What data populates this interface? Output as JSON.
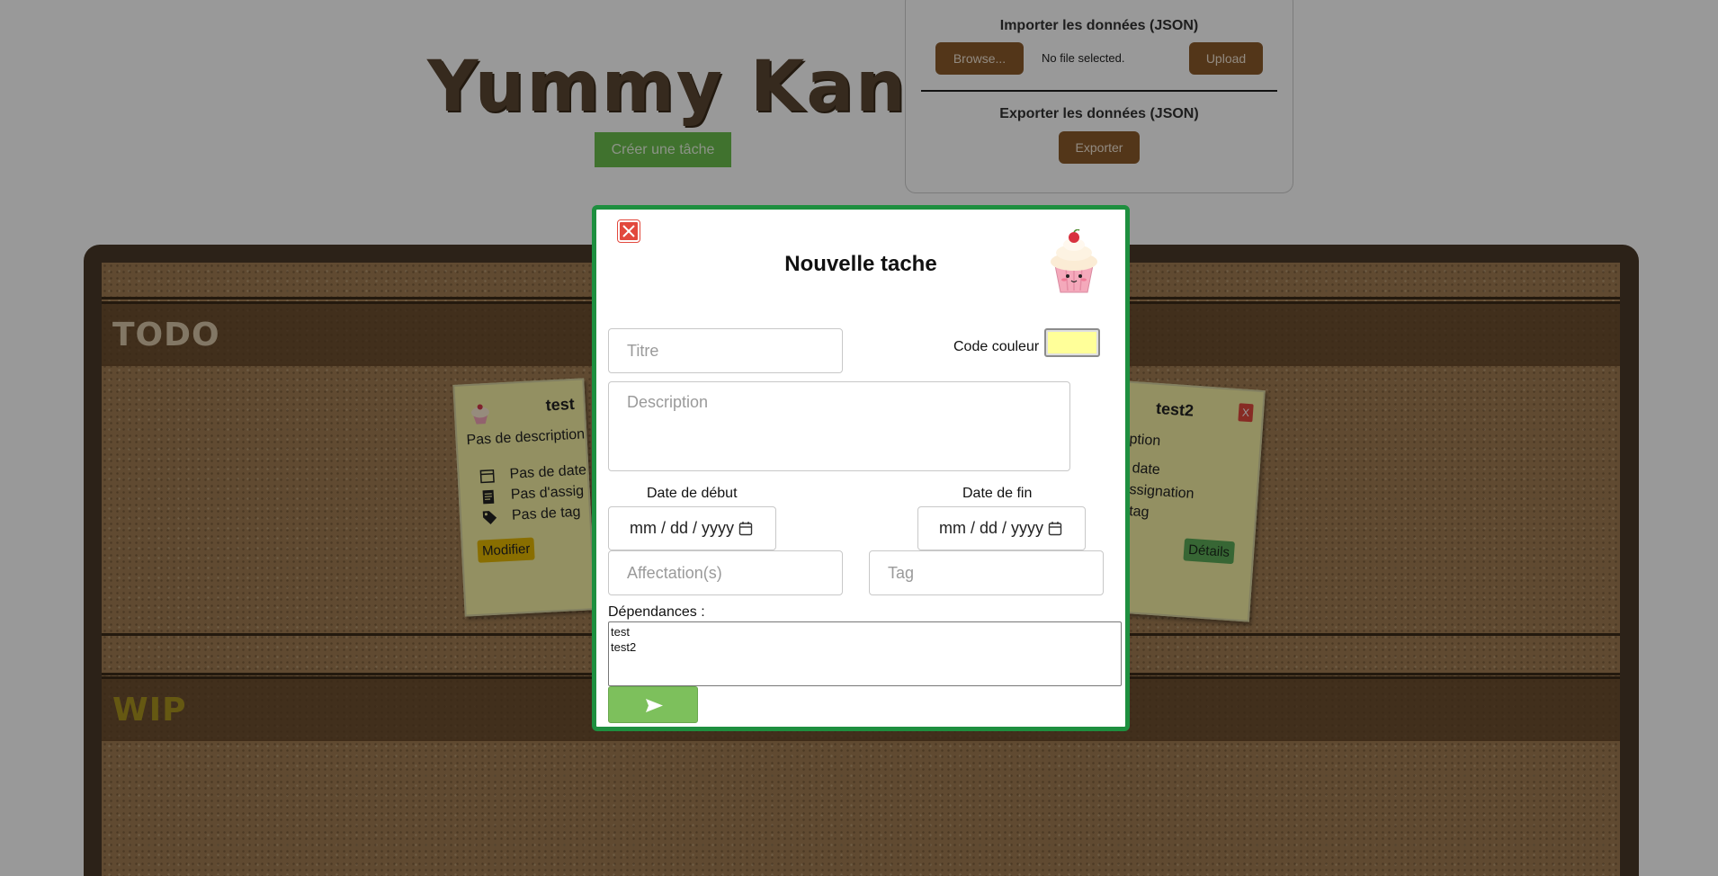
{
  "header": {
    "title": "Yummy Kanban",
    "create_button": "Créer une tâche"
  },
  "io_panel": {
    "import_title": "Importer les données (JSON)",
    "browse_label": "Browse...",
    "file_status": "No file selected.",
    "upload_label": "Upload",
    "export_title": "Exporter les données (JSON)",
    "export_label": "Exporter"
  },
  "lanes": [
    {
      "title": "TODO",
      "color": "#d9c7a8"
    },
    {
      "title": "WIP",
      "color": "#a8931e"
    }
  ],
  "cards": [
    {
      "title": "test",
      "description": "Pas de description",
      "date": "Pas de date",
      "assignment": "Pas d'assig",
      "tag": "Pas de tag",
      "button": "Modifier"
    },
    {
      "title": "test2",
      "close": "X",
      "description": "cription",
      "date": "de date",
      "assignment": "d'assignation",
      "tag": "de tag",
      "button": "Détails"
    }
  ],
  "modal": {
    "title": "Nouvelle tache",
    "title_placeholder": "Titre",
    "color_label": "Code couleur",
    "color_value": "#ffff99",
    "description_placeholder": "Description",
    "start_label": "Date de début",
    "start_value": "mm / dd / yyyy",
    "end_label": "Date de fin",
    "end_value": "mm / dd / yyyy",
    "assign_placeholder": "Affectation(s)",
    "tag_placeholder": "Tag",
    "deps_label": "Dépendances :",
    "deps_options": [
      "test",
      "test2"
    ]
  },
  "colors": {
    "modal_border": "#1e8f3f",
    "send_button": "#7dc05c",
    "close_button": "#e2483d",
    "brown_button": "#8a5a2b"
  }
}
